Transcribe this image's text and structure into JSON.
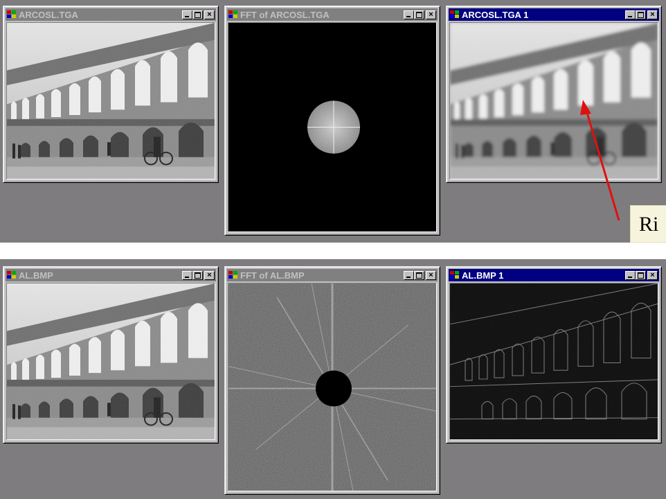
{
  "top_row": {
    "win_original": {
      "title": "ARCOSL.TGA",
      "active": false
    },
    "win_fft": {
      "title": "FFT of ARCOSL.TGA",
      "active": false
    },
    "win_result": {
      "title": "ARCOSL.TGA 1",
      "active": true
    }
  },
  "bottom_row": {
    "win_original": {
      "title": "AL.BMP",
      "active": false
    },
    "win_fft": {
      "title": "FFT of AL.BMP",
      "active": false
    },
    "win_result": {
      "title": "AL.BMP 1",
      "active": true
    }
  },
  "title_buttons": {
    "close": "×"
  },
  "callout": {
    "text": "Ri",
    "arrow_color": "#e01010"
  },
  "colors": {
    "desktop": "#7e7c7e",
    "active_title": "#000080",
    "inactive_title": "#808080",
    "window_face": "#c0c0c0"
  }
}
